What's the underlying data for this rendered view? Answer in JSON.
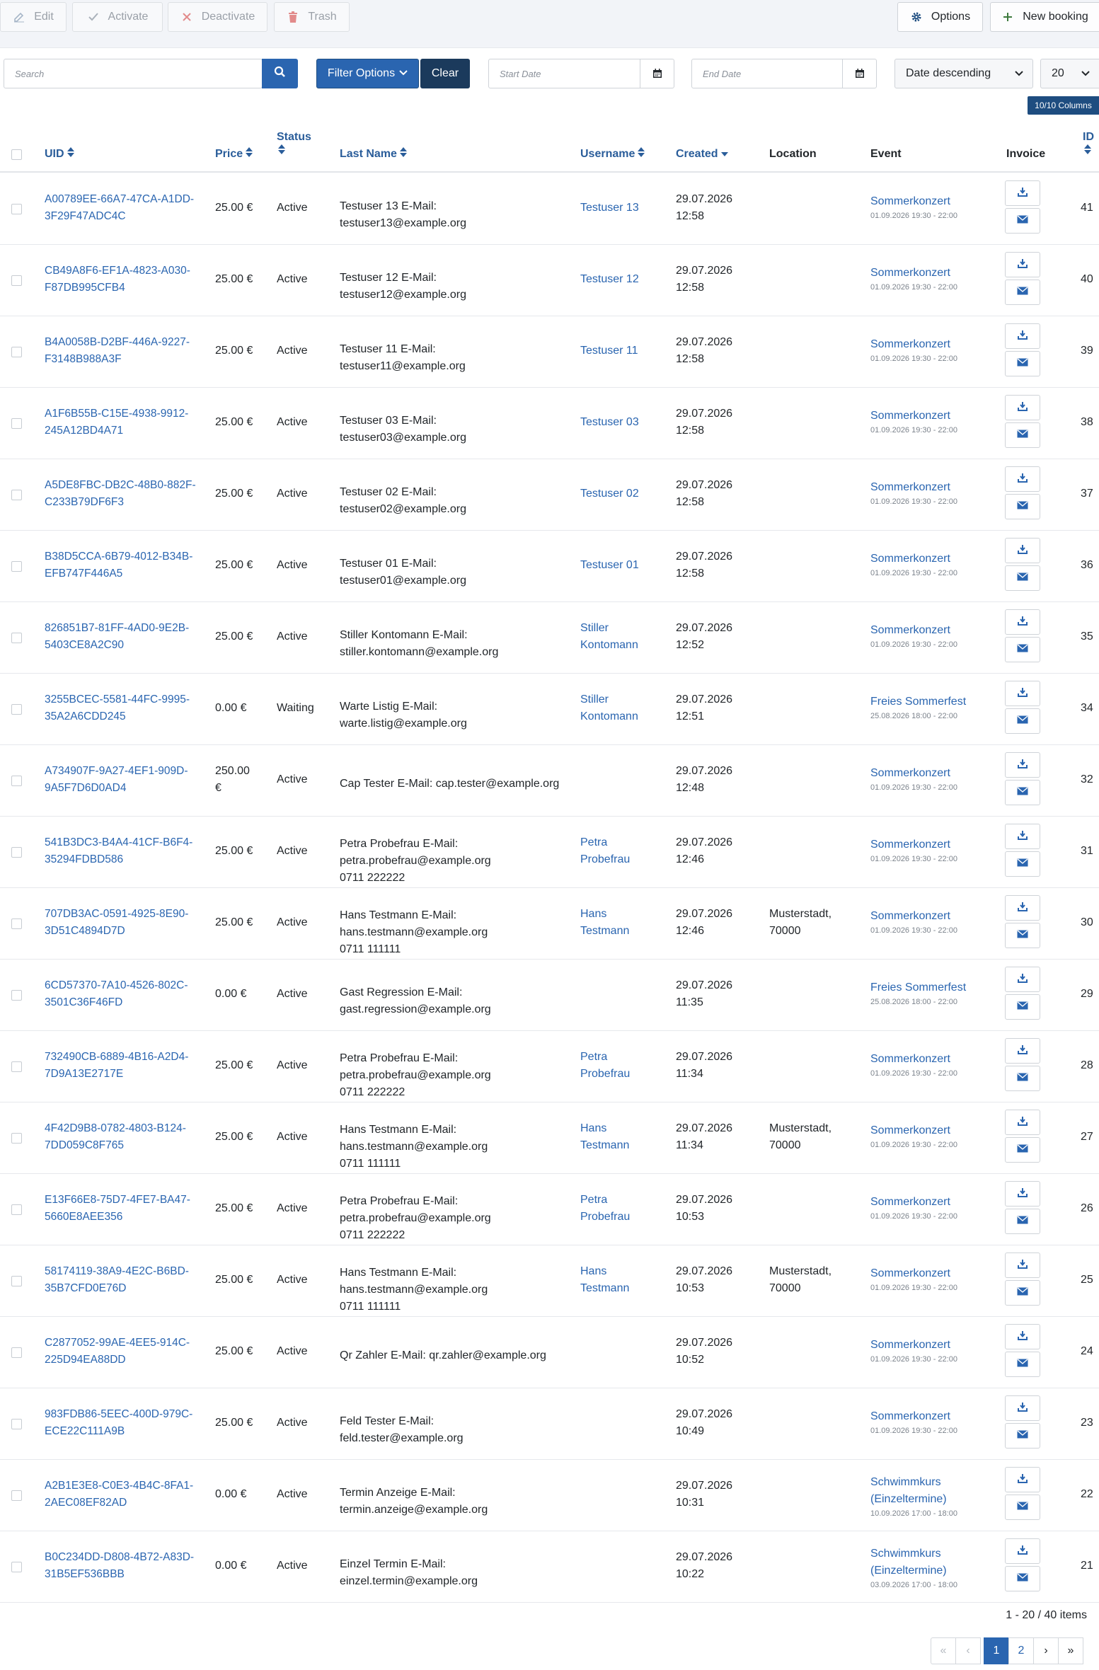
{
  "toolbar": {
    "edit": "Edit",
    "activate": "Activate",
    "deactivate": "Deactivate",
    "trash": "Trash",
    "options": "Options",
    "new_booking": "New booking"
  },
  "filters": {
    "search_placeholder": "Search",
    "filter_options": "Filter Options",
    "clear": "Clear",
    "start_date_placeholder": "Start Date",
    "end_date_placeholder": "End Date",
    "sort_value": "Date descending",
    "limit_value": "20",
    "columns_badge": "10/10 Columns"
  },
  "columns": {
    "uid": "UID",
    "price": "Price",
    "status": "Status",
    "last_name": "Last Name",
    "username": "Username",
    "created": "Created",
    "location": "Location",
    "event": "Event",
    "invoice": "Invoice",
    "id": "ID"
  },
  "rows": [
    {
      "uid1": "A00789EE-66A7-47CA-A1DD-",
      "uid2": "3F29F47ADC4C",
      "price1": "25.00 €",
      "price2": "",
      "status": "Active",
      "name1": "Testuser 13 E-Mail:",
      "name2": "testuser13@example.org",
      "name3": "",
      "user1": "Testuser 13",
      "user2": "",
      "date": "29.07.2026",
      "time": "12:58",
      "loc1": "",
      "loc2": "",
      "event1": "Sommerkonzert",
      "event2": "",
      "event_date": "01.09.2026 19:30 - 22:00",
      "id": "41"
    },
    {
      "uid1": "CB49A8F6-EF1A-4823-A030-",
      "uid2": "F87DB995CFB4",
      "price1": "25.00 €",
      "price2": "",
      "status": "Active",
      "name1": "Testuser 12 E-Mail:",
      "name2": "testuser12@example.org",
      "name3": "",
      "user1": "Testuser 12",
      "user2": "",
      "date": "29.07.2026",
      "time": "12:58",
      "loc1": "",
      "loc2": "",
      "event1": "Sommerkonzert",
      "event2": "",
      "event_date": "01.09.2026 19:30 - 22:00",
      "id": "40"
    },
    {
      "uid1": "B4A0058B-D2BF-446A-9227-",
      "uid2": "F3148B988A3F",
      "price1": "25.00 €",
      "price2": "",
      "status": "Active",
      "name1": "Testuser 11 E-Mail:",
      "name2": "testuser11@example.org",
      "name3": "",
      "user1": "Testuser 11",
      "user2": "",
      "date": "29.07.2026",
      "time": "12:58",
      "loc1": "",
      "loc2": "",
      "event1": "Sommerkonzert",
      "event2": "",
      "event_date": "01.09.2026 19:30 - 22:00",
      "id": "39"
    },
    {
      "uid1": "A1F6B55B-C15E-4938-9912-",
      "uid2": "245A12BD4A71",
      "price1": "25.00 €",
      "price2": "",
      "status": "Active",
      "name1": "Testuser 03 E-Mail:",
      "name2": "testuser03@example.org",
      "name3": "",
      "user1": "Testuser 03",
      "user2": "",
      "date": "29.07.2026",
      "time": "12:58",
      "loc1": "",
      "loc2": "",
      "event1": "Sommerkonzert",
      "event2": "",
      "event_date": "01.09.2026 19:30 - 22:00",
      "id": "38"
    },
    {
      "uid1": "A5DE8FBC-DB2C-48B0-882F-",
      "uid2": "C233B79DF6F3",
      "price1": "25.00 €",
      "price2": "",
      "status": "Active",
      "name1": "Testuser 02 E-Mail:",
      "name2": "testuser02@example.org",
      "name3": "",
      "user1": "Testuser 02",
      "user2": "",
      "date": "29.07.2026",
      "time": "12:58",
      "loc1": "",
      "loc2": "",
      "event1": "Sommerkonzert",
      "event2": "",
      "event_date": "01.09.2026 19:30 - 22:00",
      "id": "37"
    },
    {
      "uid1": "B38D5CCA-6B79-4012-B34B-",
      "uid2": "EFB747F446A5",
      "price1": "25.00 €",
      "price2": "",
      "status": "Active",
      "name1": "Testuser 01 E-Mail:",
      "name2": "testuser01@example.org",
      "name3": "",
      "user1": "Testuser 01",
      "user2": "",
      "date": "29.07.2026",
      "time": "12:58",
      "loc1": "",
      "loc2": "",
      "event1": "Sommerkonzert",
      "event2": "",
      "event_date": "01.09.2026 19:30 - 22:00",
      "id": "36"
    },
    {
      "uid1": "826851B7-81FF-4AD0-9E2B-",
      "uid2": "5403CE8A2C90",
      "price1": "25.00 €",
      "price2": "",
      "status": "Active",
      "name1": "Stiller Kontomann E-Mail:",
      "name2": "stiller.kontomann@example.org",
      "name3": "",
      "user1": "Stiller",
      "user2": "Kontomann",
      "date": "29.07.2026",
      "time": "12:52",
      "loc1": "",
      "loc2": "",
      "event1": "Sommerkonzert",
      "event2": "",
      "event_date": "01.09.2026 19:30 - 22:00",
      "id": "35"
    },
    {
      "uid1": "3255BCEC-5581-44FC-9995-",
      "uid2": "35A2A6CDD245",
      "price1": "0.00 €",
      "price2": "",
      "status": "Waiting",
      "name1": "Warte Listig E-Mail:",
      "name2": "warte.listig@example.org",
      "name3": "",
      "user1": "Stiller",
      "user2": "Kontomann",
      "date": "29.07.2026",
      "time": "12:51",
      "loc1": "",
      "loc2": "",
      "event1": "Freies Sommerfest",
      "event2": "",
      "event_date": "25.08.2026 18:00 - 22:00",
      "id": "34"
    },
    {
      "uid1": "A734907F-9A27-4EF1-909D-",
      "uid2": "9A5F7D6D0AD4",
      "price1": "250.00",
      "price2": "€",
      "status": "Active",
      "name1": "Cap Tester E-Mail: cap.tester@example.org",
      "name2": "",
      "name3": "",
      "user1": "",
      "user2": "",
      "date": "29.07.2026",
      "time": "12:48",
      "loc1": "",
      "loc2": "",
      "event1": "Sommerkonzert",
      "event2": "",
      "event_date": "01.09.2026 19:30 - 22:00",
      "id": "32"
    },
    {
      "uid1": "541B3DC3-B4A4-41CF-B6F4-",
      "uid2": "35294FDBD586",
      "price1": "25.00 €",
      "price2": "",
      "status": "Active",
      "name1": "Petra Probefrau E-Mail:",
      "name2": "petra.probefrau@example.org",
      "name3": "0711 222222",
      "user1": "Petra",
      "user2": "Probefrau",
      "date": "29.07.2026",
      "time": "12:46",
      "loc1": "",
      "loc2": "",
      "event1": "Sommerkonzert",
      "event2": "",
      "event_date": "01.09.2026 19:30 - 22:00",
      "id": "31"
    },
    {
      "uid1": "707DB3AC-0591-4925-8E90-",
      "uid2": "3D51C4894D7D",
      "price1": "25.00 €",
      "price2": "",
      "status": "Active",
      "name1": "Hans Testmann E-Mail:",
      "name2": "hans.testmann@example.org",
      "name3": "0711 111111",
      "user1": "Hans",
      "user2": "Testmann",
      "date": "29.07.2026",
      "time": "12:46",
      "loc1": "Musterstadt,",
      "loc2": "70000",
      "event1": "Sommerkonzert",
      "event2": "",
      "event_date": "01.09.2026 19:30 - 22:00",
      "id": "30"
    },
    {
      "uid1": "6CD57370-7A10-4526-802C-",
      "uid2": "3501C36F46FD",
      "price1": "0.00 €",
      "price2": "",
      "status": "Active",
      "name1": "Gast Regression E-Mail:",
      "name2": "gast.regression@example.org",
      "name3": "",
      "user1": "",
      "user2": "",
      "date": "29.07.2026",
      "time": "11:35",
      "loc1": "",
      "loc2": "",
      "event1": "Freies Sommerfest",
      "event2": "",
      "event_date": "25.08.2026 18:00 - 22:00",
      "id": "29"
    },
    {
      "uid1": "732490CB-6889-4B16-A2D4-",
      "uid2": "7D9A13E2717E",
      "price1": "25.00 €",
      "price2": "",
      "status": "Active",
      "name1": "Petra Probefrau E-Mail:",
      "name2": "petra.probefrau@example.org",
      "name3": "0711 222222",
      "user1": "Petra",
      "user2": "Probefrau",
      "date": "29.07.2026",
      "time": "11:34",
      "loc1": "",
      "loc2": "",
      "event1": "Sommerkonzert",
      "event2": "",
      "event_date": "01.09.2026 19:30 - 22:00",
      "id": "28"
    },
    {
      "uid1": "4F42D9B8-0782-4803-B124-",
      "uid2": "7DD059C8F765",
      "price1": "25.00 €",
      "price2": "",
      "status": "Active",
      "name1": "Hans Testmann E-Mail:",
      "name2": "hans.testmann@example.org",
      "name3": "0711 111111",
      "user1": "Hans",
      "user2": "Testmann",
      "date": "29.07.2026",
      "time": "11:34",
      "loc1": "Musterstadt,",
      "loc2": "70000",
      "event1": "Sommerkonzert",
      "event2": "",
      "event_date": "01.09.2026 19:30 - 22:00",
      "id": "27"
    },
    {
      "uid1": "E13F66E8-75D7-4FE7-BA47-",
      "uid2": "5660E8AEE356",
      "price1": "25.00 €",
      "price2": "",
      "status": "Active",
      "name1": "Petra Probefrau E-Mail:",
      "name2": "petra.probefrau@example.org",
      "name3": "0711 222222",
      "user1": "Petra",
      "user2": "Probefrau",
      "date": "29.07.2026",
      "time": "10:53",
      "loc1": "",
      "loc2": "",
      "event1": "Sommerkonzert",
      "event2": "",
      "event_date": "01.09.2026 19:30 - 22:00",
      "id": "26"
    },
    {
      "uid1": "58174119-38A9-4E2C-B6BD-",
      "uid2": "35B7CFD0E76D",
      "price1": "25.00 €",
      "price2": "",
      "status": "Active",
      "name1": "Hans Testmann E-Mail:",
      "name2": "hans.testmann@example.org",
      "name3": "0711 111111",
      "user1": "Hans",
      "user2": "Testmann",
      "date": "29.07.2026",
      "time": "10:53",
      "loc1": "Musterstadt,",
      "loc2": "70000",
      "event1": "Sommerkonzert",
      "event2": "",
      "event_date": "01.09.2026 19:30 - 22:00",
      "id": "25"
    },
    {
      "uid1": "C2877052-99AE-4EE5-914C-",
      "uid2": "225D94EA88DD",
      "price1": "25.00 €",
      "price2": "",
      "status": "Active",
      "name1": "Qr Zahler E-Mail: qr.zahler@example.org",
      "name2": "",
      "name3": "",
      "user1": "",
      "user2": "",
      "date": "29.07.2026",
      "time": "10:52",
      "loc1": "",
      "loc2": "",
      "event1": "Sommerkonzert",
      "event2": "",
      "event_date": "01.09.2026 19:30 - 22:00",
      "id": "24"
    },
    {
      "uid1": "983FDB86-5EEC-400D-979C-",
      "uid2": "ECE22C111A9B",
      "price1": "25.00 €",
      "price2": "",
      "status": "Active",
      "name1": "Feld Tester E-Mail:",
      "name2": "feld.tester@example.org",
      "name3": "",
      "user1": "",
      "user2": "",
      "date": "29.07.2026",
      "time": "10:49",
      "loc1": "",
      "loc2": "",
      "event1": "Sommerkonzert",
      "event2": "",
      "event_date": "01.09.2026 19:30 - 22:00",
      "id": "23"
    },
    {
      "uid1": "A2B1E3E8-C0E3-4B4C-8FA1-",
      "uid2": "2AEC08EF82AD",
      "price1": "0.00 €",
      "price2": "",
      "status": "Active",
      "name1": "Termin Anzeige E-Mail:",
      "name2": "termin.anzeige@example.org",
      "name3": "",
      "user1": "",
      "user2": "",
      "date": "29.07.2026",
      "time": "10:31",
      "loc1": "",
      "loc2": "",
      "event1": "Schwimmkurs",
      "event2": "(Einzeltermine)",
      "event_date": "10.09.2026 17:00 - 18:00",
      "id": "22"
    },
    {
      "uid1": "B0C234DD-D808-4B72-A83D-",
      "uid2": "31B5EF536BBB",
      "price1": "0.00 €",
      "price2": "",
      "status": "Active",
      "name1": "Einzel Termin E-Mail:",
      "name2": "einzel.termin@example.org",
      "name3": "",
      "user1": "",
      "user2": "",
      "date": "29.07.2026",
      "time": "10:22",
      "loc1": "",
      "loc2": "",
      "event1": "Schwimmkurs",
      "event2": "(Einzeltermine)",
      "event_date": "03.09.2026 17:00 - 18:00",
      "id": "21"
    }
  ],
  "footer": {
    "count_text": "1 - 20 / 40 items",
    "page_current": "1",
    "page_next": "2",
    "first_symbol": "«",
    "prev_symbol": "‹",
    "next_symbol": "›",
    "last_symbol": "»"
  },
  "colors": {
    "primary": "#2a65b0",
    "dark_blue": "#1e4d80",
    "button_dark": "#1b3a5c"
  }
}
